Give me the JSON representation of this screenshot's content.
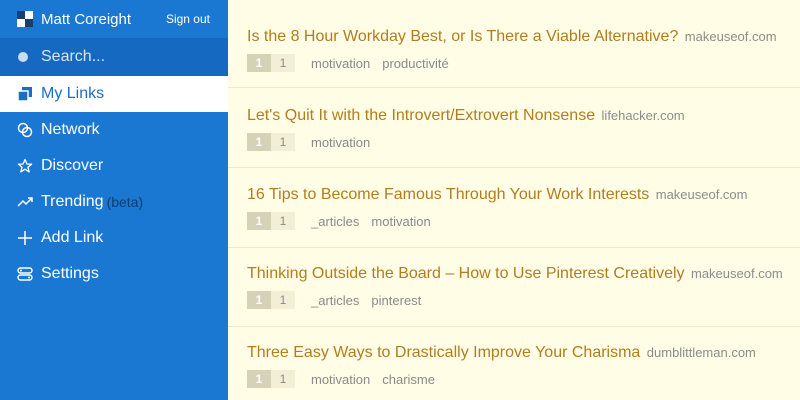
{
  "header": {
    "user_name": "Matt Coreight",
    "sign_out_label": "Sign out"
  },
  "search": {
    "placeholder": "Search..."
  },
  "nav": {
    "items": [
      {
        "label": "My Links",
        "icon": "stack-icon",
        "active": true
      },
      {
        "label": "Network",
        "icon": "network-icon"
      },
      {
        "label": "Discover",
        "icon": "star-icon"
      },
      {
        "label": "Trending",
        "icon": "trending-icon",
        "badge": "(beta)"
      },
      {
        "label": "Add Link",
        "icon": "plus-icon"
      },
      {
        "label": "Settings",
        "icon": "settings-icon"
      }
    ]
  },
  "links": [
    {
      "title": "Is the 8 Hour Workday Best, or Is There a Viable Alternative?",
      "domain": "makeuseof.com",
      "count_a": "1",
      "count_b": "1",
      "tags": [
        "motivation",
        "productivité"
      ]
    },
    {
      "title": "Let's Quit It with the Introvert/Extrovert Nonsense",
      "domain": "lifehacker.com",
      "count_a": "1",
      "count_b": "1",
      "tags": [
        "motivation"
      ]
    },
    {
      "title": "16 Tips to Become Famous Through Your Work Interests",
      "domain": "makeuseof.com",
      "count_a": "1",
      "count_b": "1",
      "tags": [
        "_articles",
        "motivation"
      ]
    },
    {
      "title": "Thinking Outside the Board – How to Use Pinterest Creatively",
      "domain": "makeuseof.com",
      "count_a": "1",
      "count_b": "1",
      "tags": [
        "_articles",
        "pinterest"
      ]
    },
    {
      "title": "Three Easy Ways to Drastically Improve Your Charisma",
      "domain": "dumblittleman.com",
      "count_a": "1",
      "count_b": "1",
      "tags": [
        "motivation",
        "charisme"
      ]
    }
  ],
  "colors": {
    "sidebar": "#1a78d2",
    "search_bg": "#1669c0",
    "content_bg": "#fffde6",
    "title": "#b27d1f",
    "active_text": "#1a6fc4"
  }
}
